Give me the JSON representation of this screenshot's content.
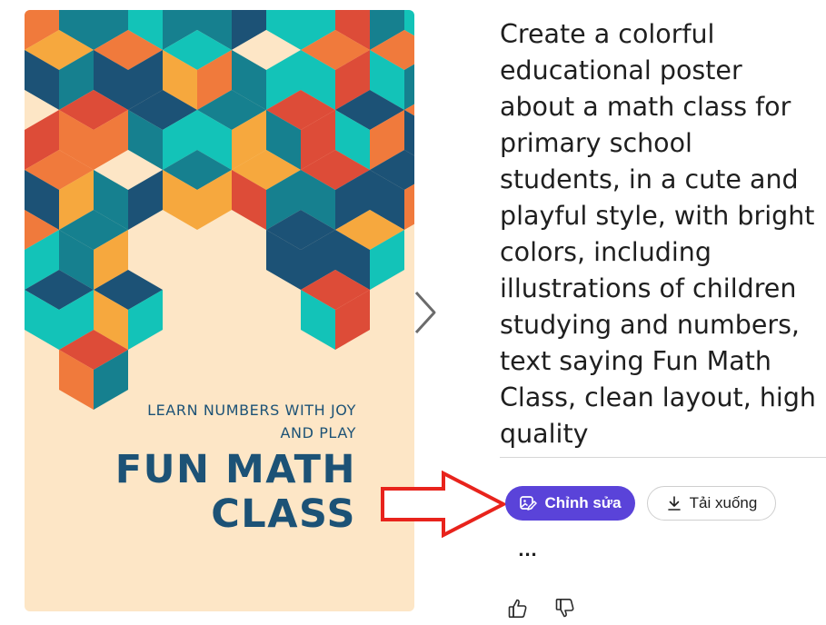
{
  "poster": {
    "tagline_line1": "LEARN NUMBERS WITH JOY",
    "tagline_line2": "AND PLAY",
    "title_line1": "FUN MATH",
    "title_line2": "CLASS",
    "colors": {
      "background": "#FDE6C6",
      "navy": "#1C5276",
      "teal": "#16808F",
      "aqua": "#13C3B8",
      "orange": "#F07A3C",
      "yellow": "#F6A83E",
      "red": "#DD4C38",
      "cream": "#FDE6C6"
    }
  },
  "prompt_text": "Create a colorful educational poster about a math class for primary school students, in a cute and playful style, with bright colors, including illustrations of children studying and numbers, text saying Fun Math Class, clean layout, high quality",
  "actions": {
    "edit_label": "Chỉnh sửa",
    "download_label": "Tải xuống",
    "more_label": "...",
    "accent_color": "#5A43D9",
    "annotation_arrow_color": "#E8231C"
  },
  "icons": {
    "next": "chevron-right-icon",
    "edit": "edit-image-icon",
    "download": "download-icon",
    "like": "thumbs-up-icon",
    "dislike": "thumbs-down-icon"
  }
}
